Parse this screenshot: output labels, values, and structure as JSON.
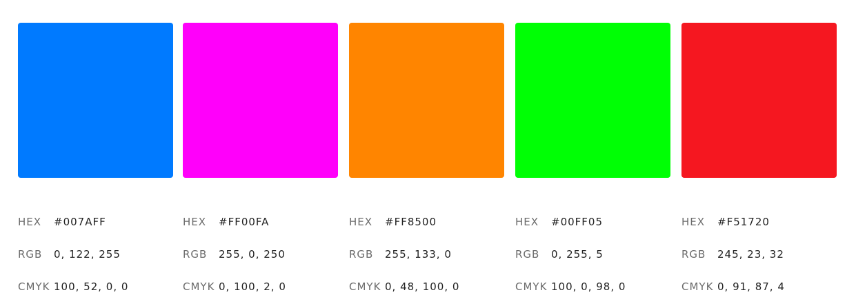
{
  "labels": {
    "hex": "HEX",
    "rgb": "RGB",
    "cmyk": "CMYK"
  },
  "swatches": [
    {
      "color": "#007AFF",
      "hex": "#007AFF",
      "rgb": "0, 122, 255",
      "cmyk": "100, 52, 0, 0"
    },
    {
      "color": "#FF00FA",
      "hex": "#FF00FA",
      "rgb": "255, 0, 250",
      "cmyk": "0, 100, 2, 0"
    },
    {
      "color": "#FF8500",
      "hex": "#FF8500",
      "rgb": "255, 133, 0",
      "cmyk": "0, 48, 100, 0"
    },
    {
      "color": "#00FF05",
      "hex": "#00FF05",
      "rgb": "0, 255, 5",
      "cmyk": "100, 0, 98, 0"
    },
    {
      "color": "#F51720",
      "hex": "#F51720",
      "rgb": "245, 23, 32",
      "cmyk": "0, 91, 87, 4"
    }
  ]
}
